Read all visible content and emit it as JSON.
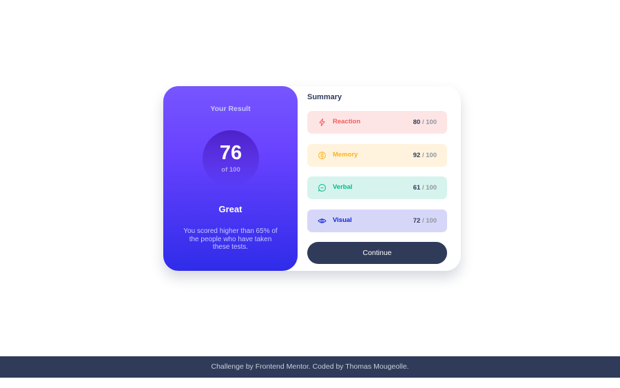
{
  "result": {
    "title": "Your Result",
    "score": "76",
    "of_label": "of 100",
    "grade": "Great",
    "description": "You scored higher than 65% of the people who have taken these tests.",
    "gradient_top": "#7755ff",
    "gradient_bottom": "#2f2ce9"
  },
  "summary": {
    "title": "Summary",
    "items": [
      {
        "label": "Reaction",
        "score": "80",
        "max": " / 100",
        "icon": "lightning-icon",
        "color": "#f55b5b",
        "bg": "#fee5e5"
      },
      {
        "label": "Memory",
        "score": "92",
        "max": " / 100",
        "icon": "brain-icon",
        "color": "#ffb11e",
        "bg": "#fff3dd"
      },
      {
        "label": "Verbal",
        "score": "61",
        "max": " / 100",
        "icon": "chat-bubble-icon",
        "color": "#00bb8f",
        "bg": "#d6f4ed"
      },
      {
        "label": "Visual",
        "score": "72",
        "max": " / 100",
        "icon": "eye-icon",
        "color": "#1125d4",
        "bg": "#d6d7f8"
      }
    ],
    "continue_label": "Continue"
  },
  "footer": {
    "text": "Challenge by Frontend Mentor. Coded by Thomas Mougeolle."
  }
}
